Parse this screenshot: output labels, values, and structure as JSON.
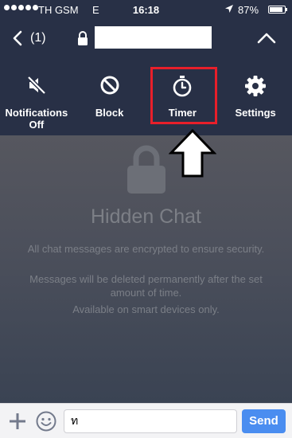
{
  "status_bar": {
    "carrier": "TH GSM",
    "network": "E",
    "time": "16:18",
    "battery_percent": "87%",
    "battery_level": 0.87,
    "signal_icon": "signal-dots-icon",
    "location_icon": "location-arrow-icon",
    "battery_icon": "battery-icon"
  },
  "nav_bar": {
    "back_icon": "chevron-left-icon",
    "unread_count": "(1)",
    "lock_icon": "lock-icon",
    "collapse_icon": "chevron-up-icon"
  },
  "menu": {
    "items": [
      {
        "label": "Notifications Off",
        "icon": "muted-speaker-icon"
      },
      {
        "label": "Block",
        "icon": "block-icon"
      },
      {
        "label": "Timer",
        "icon": "stopwatch-icon"
      },
      {
        "label": "Settings",
        "icon": "gear-icon"
      }
    ]
  },
  "hidden_chat": {
    "title": "Hidden Chat",
    "lines": [
      "All chat messages are encrypted to ensure security.",
      "Messages will be deleted permanently after the set amount of time.",
      "Available on smart devices only."
    ]
  },
  "annotation": {
    "highlight_color": "#e81f2a",
    "arrow_icon": "up-arrow-icon"
  },
  "input_bar": {
    "message_value": "ท",
    "send_label": "Send",
    "plus_icon": "plus-icon",
    "emoji_icon": "smiley-icon"
  },
  "colors": {
    "header_bg": "#283046",
    "send_button": "#4a8df0"
  }
}
